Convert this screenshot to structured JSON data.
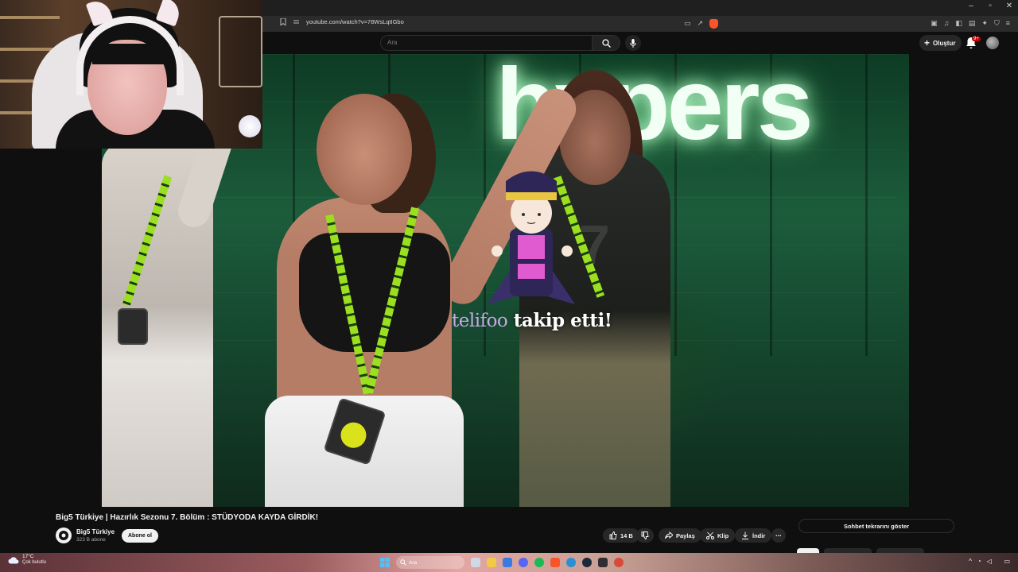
{
  "browser": {
    "url": "youtube.com/watch?v=78WsLqtIGbo",
    "window_controls": [
      "–",
      "▫",
      "✕"
    ]
  },
  "youtube": {
    "search_placeholder": "Ara",
    "create_label": "Oluştur",
    "notification_count": "9+"
  },
  "video": {
    "overlay_sign": "hypers",
    "jersey_number": "7",
    "alert": {
      "username": "telifoo",
      "message": "takip etti!"
    }
  },
  "watch": {
    "title": "Big5 Türkiye | Hazırlık Sezonu 7. Bölüm : STÜDYODA KAYDA GİRDİK!",
    "channel_name": "Big5 Türkiye",
    "subscribers": "323 B abone",
    "subscribe_label": "Abone ol",
    "like_count": "14 B",
    "share_label": "Paylaş",
    "clip_label": "Klip",
    "download_label": "İndir",
    "more_label": "⋯",
    "chat_button_label": "Sohbet tekrarını göster"
  },
  "taskbar": {
    "weather_temp": "17°C",
    "weather_desc": "Çok bulutlu",
    "search_label": "Ara"
  },
  "colors": {
    "youtube_bg": "#0f0f0f",
    "alert_username": "#c8a8e6",
    "brave_brand": "#fb542b"
  }
}
